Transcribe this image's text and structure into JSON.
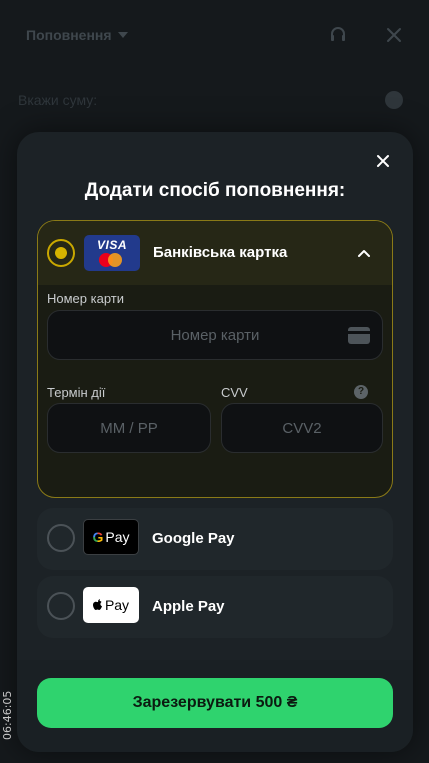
{
  "background": {
    "title": "Поповнення",
    "amount_label": "Вкажи суму:",
    "icons": [
      "chevron-down-icon",
      "headset-icon",
      "close-icon",
      "info-icon"
    ]
  },
  "modal": {
    "title": "Додати спосіб поповнення:",
    "close_icon": "close-icon",
    "bank_card": {
      "label": "Банківська картка",
      "selected": true,
      "logo_text": "VISA",
      "card_number_label": "Номер карти",
      "card_number_placeholder": "Номер карти",
      "expiry_label": "Термін дії",
      "expiry_placeholder": "MM / PP",
      "cvv_label": "CVV",
      "cvv_placeholder": "CVV2"
    },
    "google_pay": {
      "label": "Google Pay",
      "logo_text": "Pay"
    },
    "apple_pay": {
      "label": "Apple Pay",
      "logo_text": "Pay"
    },
    "submit_label": "Зарезервувати 500 ₴"
  },
  "timestamp": "06:46:05",
  "colors": {
    "accent": "#2fd36e",
    "selected_border": "#8a7a17",
    "radio_selected": "#d6b300"
  }
}
